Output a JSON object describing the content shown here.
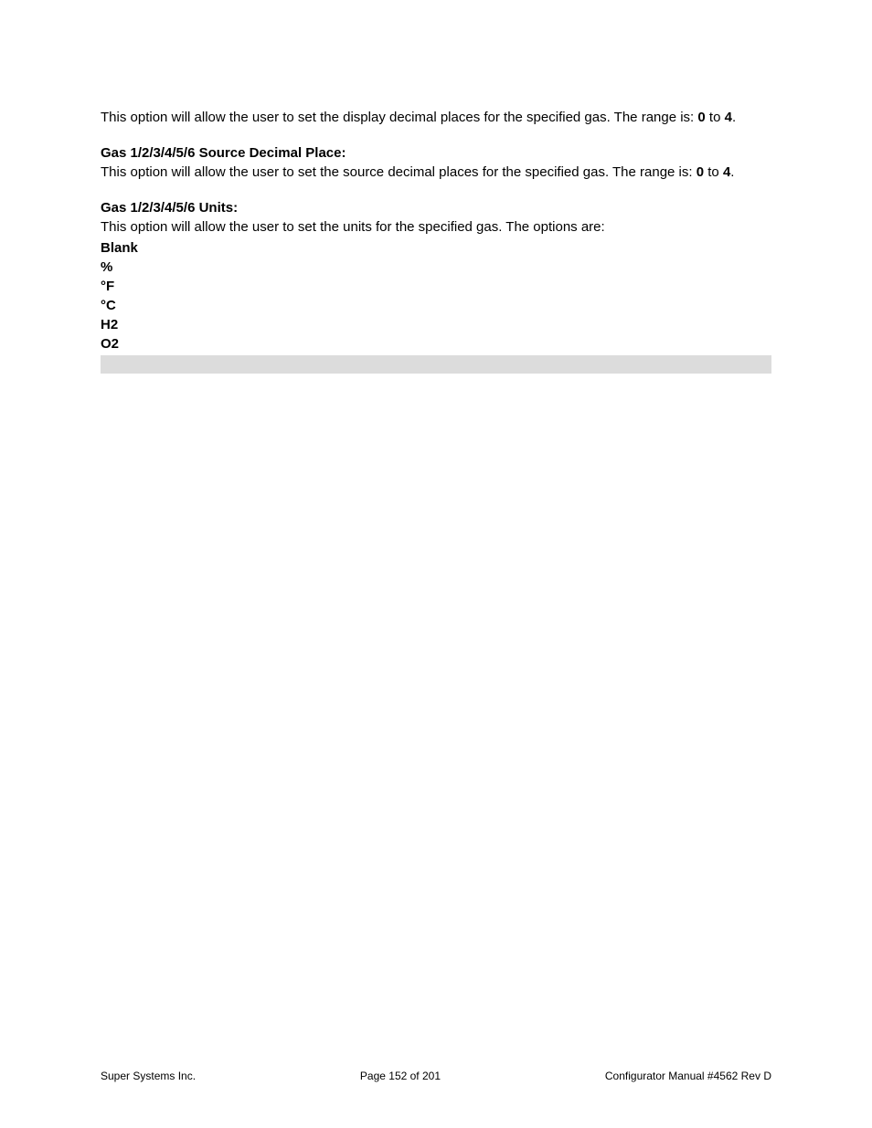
{
  "section1": {
    "intro_a": "This option will allow the user to set the display decimal places for the specified gas.  The range is: ",
    "range_min": "0",
    "to": " to ",
    "range_max": "4",
    "period": "."
  },
  "section2": {
    "heading": "Gas 1/2/3/4/5/6 Source Decimal Place:",
    "intro_a": "This option will allow the user to set the source decimal places for the specified gas.  The range is: ",
    "range_min": "0",
    "to": " to ",
    "range_max": "4",
    "period": "."
  },
  "section3": {
    "heading": "Gas 1/2/3/4/5/6 Units:",
    "intro": "This option will allow the user to set the units for the specified gas.  The options are:",
    "units": {
      "u0": "Blank",
      "u1": "%",
      "u2": "°F",
      "u3": "°C",
      "u4": "H2",
      "u5": "O2"
    }
  },
  "footer": {
    "left": "Super Systems Inc.",
    "center": "Page 152 of 201",
    "right": "Configurator Manual #4562 Rev D"
  }
}
